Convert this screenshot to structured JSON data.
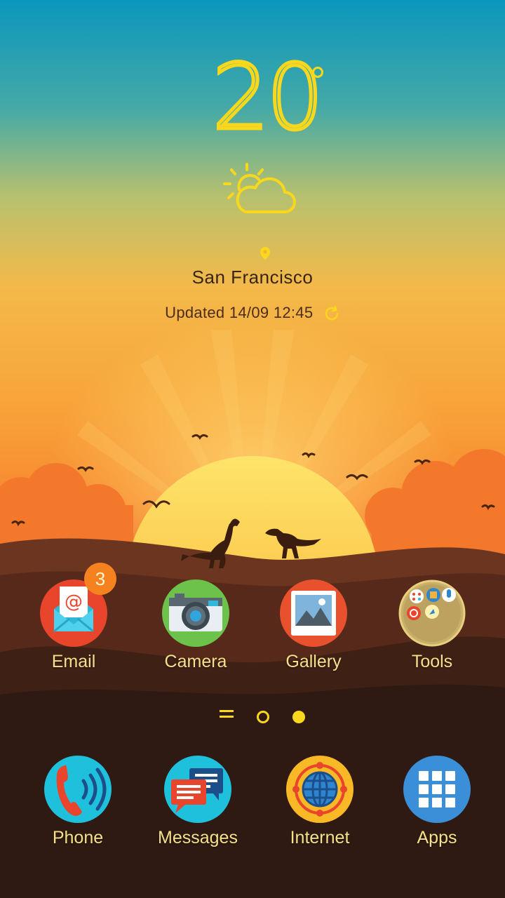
{
  "weather": {
    "temperature": "20",
    "condition_icon": "partly-cloudy-icon",
    "location_icon": "location-pin-icon",
    "city": "San Francisco",
    "updated": "Updated 14/09 12:45",
    "refresh_icon": "refresh-icon"
  },
  "home_apps": [
    {
      "label": "Email",
      "icon": "email-icon",
      "badge": "3"
    },
    {
      "label": "Camera",
      "icon": "camera-icon"
    },
    {
      "label": "Gallery",
      "icon": "gallery-icon"
    },
    {
      "label": "Tools",
      "icon": "tools-folder-icon"
    }
  ],
  "pager": {
    "menu_icon": "page-menu-icon",
    "pages": 2,
    "current_page": 2
  },
  "dock_apps": [
    {
      "label": "Phone",
      "icon": "phone-icon"
    },
    {
      "label": "Messages",
      "icon": "messages-icon"
    },
    {
      "label": "Internet",
      "icon": "internet-icon"
    },
    {
      "label": "Apps",
      "icon": "apps-grid-icon"
    }
  ],
  "colors": {
    "accent_yellow": "#f9d71c",
    "label_text": "#f6e08a",
    "badge": "#f5821f"
  }
}
